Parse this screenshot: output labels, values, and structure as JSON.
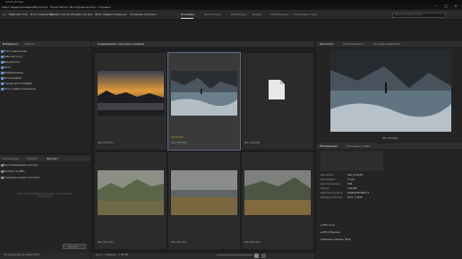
{
  "window": {
    "title": "Adobe Bridge"
  },
  "menu": [
    "Файл",
    "Редактирование",
    "Просмотр",
    "Пакет",
    "Метки",
    "Инструменты",
    "Окно",
    "Справка"
  ],
  "path": {
    "crumbs": [
      "Рабочий стол",
      "Этот компьютер",
      "Новый том (D:)",
      "Новый том (D:)",
      "Фото первостепенные",
      "Сложные (съемки)"
    ]
  },
  "workspaces": [
    "Основное",
    "Библиотеки",
    "Диафильм",
    "Вывод",
    "Метаданные",
    "Ключевые слова"
  ],
  "active_workspace": 0,
  "search": {
    "placeholder": "Поиск: Текущая папка"
  },
  "left": {
    "tabs": [
      "Избранное",
      "Папки"
    ],
    "favorites": [
      "Этот компьютер",
      "Рабочий стол",
      "Документы",
      "Фото",
      "Изображения",
      "Фотографии",
      "Студио фотографии",
      "Фото первостепенные"
    ],
    "lower_tabs": [
      "Коллекции",
      "Фильтр",
      "Экспорт"
    ],
    "lower_items": [
      "Настраиваемый экспорт",
      "Экспорт в JPEG",
      "Создание нового экспорт"
    ],
    "drop_hint": "Перетащите изображения сюда, чтобы добавить их в экспорт",
    "export_btn": "Экспорт",
    "footer": "Экспортируйте в Adobe Stock"
  },
  "content": {
    "tabs": [
      "Содержимое: Сложные (съемки)"
    ],
    "items": [
      {
        "caption": "IMG_0756.JPG",
        "selected": false
      },
      {
        "caption": "IMG_0756.JPG",
        "selected": true
      },
      {
        "caption": "IMG_4564.JPG",
        "selected": false
      },
      {
        "caption": "IMG_0821.JPG",
        "selected": false
      },
      {
        "caption": "IMG_0821.JPG",
        "selected": false
      },
      {
        "caption": "IMG_0834.JPG",
        "selected": false
      }
    ],
    "status": "16 эл., 1 выбрано – 1.96 МБ"
  },
  "right": {
    "tabs": [
      "Просмотр",
      "Опубликовать",
      "Быстрые действия"
    ],
    "preview_caption": "IMG_0756.JPG",
    "meta_tabs": [
      "Метаданные",
      "Ключевые слова"
    ],
    "rows": [
      [
        "Имя файла",
        "IMG_0756.JPG"
      ],
      [
        "Разрешение",
        "72 ppi"
      ],
      [
        "Цветовой режим",
        "RGB"
      ],
      [
        "Размер",
        "1.96 МБ"
      ],
      [
        "Цветовой профиль",
        "sRGB IEC61966-2.1"
      ],
      [
        "Размер в пикселях",
        "5472 × 3648"
      ]
    ],
    "sections": [
      "IPTC Core",
      "IPTC Extension",
      "Данные камеры (Exif)"
    ]
  }
}
